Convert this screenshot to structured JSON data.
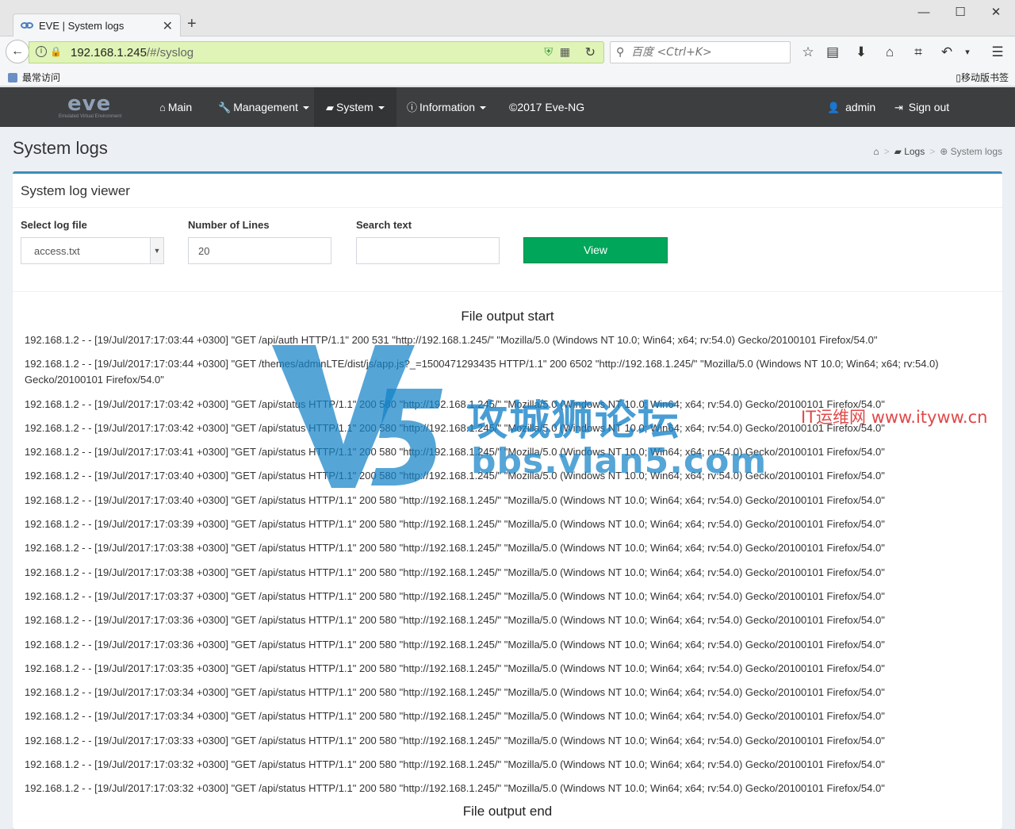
{
  "browser": {
    "tab_title": "EVE | System logs",
    "url_host": "192.168.1.245",
    "url_path": "/#/syslog",
    "search_placeholder": "百度 <Ctrl+K>",
    "bookmark_left": "最常访问",
    "bookmark_right": "移动版书签"
  },
  "app": {
    "logo": "eve",
    "logo_sub": "Emulated Virtual Environment",
    "nav": {
      "main": "Main",
      "management": "Management",
      "system": "System",
      "information": "Information",
      "copyright": "©2017 Eve-NG",
      "user": "admin",
      "signout": "Sign out"
    }
  },
  "page": {
    "title": "System logs",
    "breadcrumb": {
      "logs": "Logs",
      "current": "System logs"
    },
    "box_title": "System log viewer",
    "form": {
      "select_log_label": "Select log file",
      "select_log_value": "access.txt",
      "lines_label": "Number of Lines",
      "lines_value": "20",
      "search_label": "Search text",
      "search_value": "",
      "view_button": "View"
    },
    "output_start": "File output start",
    "output_end": "File output end",
    "log_lines": [
      "192.168.1.2 - - [19/Jul/2017:17:03:44 +0300] \"GET /api/auth HTTP/1.1\" 200 531 \"http://192.168.1.245/\" \"Mozilla/5.0 (Windows NT 10.0; Win64; x64; rv:54.0) Gecko/20100101 Firefox/54.0\"",
      "192.168.1.2 - - [19/Jul/2017:17:03:44 +0300] \"GET /themes/adminLTE/dist/js/app.js?_=1500471293435 HTTP/1.1\" 200 6502 \"http://192.168.1.245/\" \"Mozilla/5.0 (Windows NT 10.0; Win64; x64; rv:54.0) Gecko/20100101 Firefox/54.0\"",
      "192.168.1.2 - - [19/Jul/2017:17:03:42 +0300] \"GET /api/status HTTP/1.1\" 200 580 \"http://192.168.1.245/\" \"Mozilla/5.0 (Windows NT 10.0; Win64; x64; rv:54.0) Gecko/20100101 Firefox/54.0\"",
      "192.168.1.2 - - [19/Jul/2017:17:03:42 +0300] \"GET /api/status HTTP/1.1\" 200 580 \"http://192.168.1.245/\" \"Mozilla/5.0 (Windows NT 10.0; Win64; x64; rv:54.0) Gecko/20100101 Firefox/54.0\"",
      "192.168.1.2 - - [19/Jul/2017:17:03:41 +0300] \"GET /api/status HTTP/1.1\" 200 580 \"http://192.168.1.245/\" \"Mozilla/5.0 (Windows NT 10.0; Win64; x64; rv:54.0) Gecko/20100101 Firefox/54.0\"",
      "192.168.1.2 - - [19/Jul/2017:17:03:40 +0300] \"GET /api/status HTTP/1.1\" 200 580 \"http://192.168.1.245/\" \"Mozilla/5.0 (Windows NT 10.0; Win64; x64; rv:54.0) Gecko/20100101 Firefox/54.0\"",
      "192.168.1.2 - - [19/Jul/2017:17:03:40 +0300] \"GET /api/status HTTP/1.1\" 200 580 \"http://192.168.1.245/\" \"Mozilla/5.0 (Windows NT 10.0; Win64; x64; rv:54.0) Gecko/20100101 Firefox/54.0\"",
      "192.168.1.2 - - [19/Jul/2017:17:03:39 +0300] \"GET /api/status HTTP/1.1\" 200 580 \"http://192.168.1.245/\" \"Mozilla/5.0 (Windows NT 10.0; Win64; x64; rv:54.0) Gecko/20100101 Firefox/54.0\"",
      "192.168.1.2 - - [19/Jul/2017:17:03:38 +0300] \"GET /api/status HTTP/1.1\" 200 580 \"http://192.168.1.245/\" \"Mozilla/5.0 (Windows NT 10.0; Win64; x64; rv:54.0) Gecko/20100101 Firefox/54.0\"",
      "192.168.1.2 - - [19/Jul/2017:17:03:38 +0300] \"GET /api/status HTTP/1.1\" 200 580 \"http://192.168.1.245/\" \"Mozilla/5.0 (Windows NT 10.0; Win64; x64; rv:54.0) Gecko/20100101 Firefox/54.0\"",
      "192.168.1.2 - - [19/Jul/2017:17:03:37 +0300] \"GET /api/status HTTP/1.1\" 200 580 \"http://192.168.1.245/\" \"Mozilla/5.0 (Windows NT 10.0; Win64; x64; rv:54.0) Gecko/20100101 Firefox/54.0\"",
      "192.168.1.2 - - [19/Jul/2017:17:03:36 +0300] \"GET /api/status HTTP/1.1\" 200 580 \"http://192.168.1.245/\" \"Mozilla/5.0 (Windows NT 10.0; Win64; x64; rv:54.0) Gecko/20100101 Firefox/54.0\"",
      "192.168.1.2 - - [19/Jul/2017:17:03:36 +0300] \"GET /api/status HTTP/1.1\" 200 580 \"http://192.168.1.245/\" \"Mozilla/5.0 (Windows NT 10.0; Win64; x64; rv:54.0) Gecko/20100101 Firefox/54.0\"",
      "192.168.1.2 - - [19/Jul/2017:17:03:35 +0300] \"GET /api/status HTTP/1.1\" 200 580 \"http://192.168.1.245/\" \"Mozilla/5.0 (Windows NT 10.0; Win64; x64; rv:54.0) Gecko/20100101 Firefox/54.0\"",
      "192.168.1.2 - - [19/Jul/2017:17:03:34 +0300] \"GET /api/status HTTP/1.1\" 200 580 \"http://192.168.1.245/\" \"Mozilla/5.0 (Windows NT 10.0; Win64; x64; rv:54.0) Gecko/20100101 Firefox/54.0\"",
      "192.168.1.2 - - [19/Jul/2017:17:03:34 +0300] \"GET /api/status HTTP/1.1\" 200 580 \"http://192.168.1.245/\" \"Mozilla/5.0 (Windows NT 10.0; Win64; x64; rv:54.0) Gecko/20100101 Firefox/54.0\"",
      "192.168.1.2 - - [19/Jul/2017:17:03:33 +0300] \"GET /api/status HTTP/1.1\" 200 580 \"http://192.168.1.245/\" \"Mozilla/5.0 (Windows NT 10.0; Win64; x64; rv:54.0) Gecko/20100101 Firefox/54.0\"",
      "192.168.1.2 - - [19/Jul/2017:17:03:32 +0300] \"GET /api/status HTTP/1.1\" 200 580 \"http://192.168.1.245/\" \"Mozilla/5.0 (Windows NT 10.0; Win64; x64; rv:54.0) Gecko/20100101 Firefox/54.0\"",
      "192.168.1.2 - - [19/Jul/2017:17:03:32 +0300] \"GET /api/status HTTP/1.1\" 200 580 \"http://192.168.1.245/\" \"Mozilla/5.0 (Windows NT 10.0; Win64; x64; rv:54.0) Gecko/20100101 Firefox/54.0\""
    ]
  },
  "watermark": {
    "cn": "攻城狮论坛",
    "url": "bbs.vlan5.com",
    "it": "IT运维网 www.ityww.cn"
  },
  "colors": {
    "header_bg": "#3c3e40",
    "box_accent": "#3c8dbc",
    "view_button": "#00a65a",
    "urlbar_bg": "#dff4b6"
  }
}
